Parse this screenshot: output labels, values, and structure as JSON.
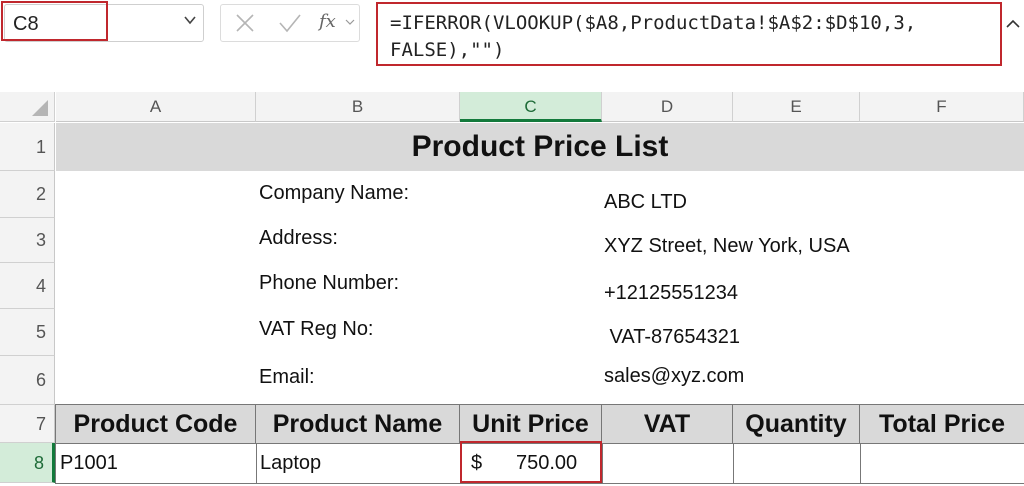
{
  "formula_bar": {
    "name_box": "C8",
    "formula": "=IFERROR(VLOOKUP($A8,ProductData!$A$2:$D$10,3,FALSE),\"\")",
    "formula_line1": "=IFERROR(VLOOKUP($A8,ProductData!$A$2:$D$10,3,",
    "formula_line2": "FALSE),\"\")",
    "fx_label": "fx"
  },
  "columns": [
    "A",
    "B",
    "C",
    "D",
    "E",
    "F"
  ],
  "rows": [
    "1",
    "2",
    "3",
    "4",
    "5",
    "6",
    "7",
    "8"
  ],
  "selected_cell": "C8",
  "sheet": {
    "title": "Product Price List",
    "info": [
      {
        "label": "Company Name:",
        "value": "ABC LTD"
      },
      {
        "label": "Address:",
        "value": "XYZ Street, New York, USA"
      },
      {
        "label": "Phone Number:",
        "value": "+12125551234"
      },
      {
        "label": "VAT Reg No:",
        "value": " VAT-87654321"
      },
      {
        "label": "Email:",
        "value": "sales@xyz.com"
      }
    ],
    "table_headers": [
      "Product Code",
      "Product Name",
      "Unit Price",
      "VAT",
      "Quantity",
      "Total Price"
    ],
    "row8": {
      "product_code": "P1001",
      "product_name": "Laptop",
      "unit_price_currency": "$",
      "unit_price": "750.00",
      "vat": "",
      "quantity": "",
      "total_price": ""
    }
  },
  "colors": {
    "highlight_red": "#c0272d",
    "selection_green": "#137a3c",
    "header_fill": "#d9d9d9"
  }
}
